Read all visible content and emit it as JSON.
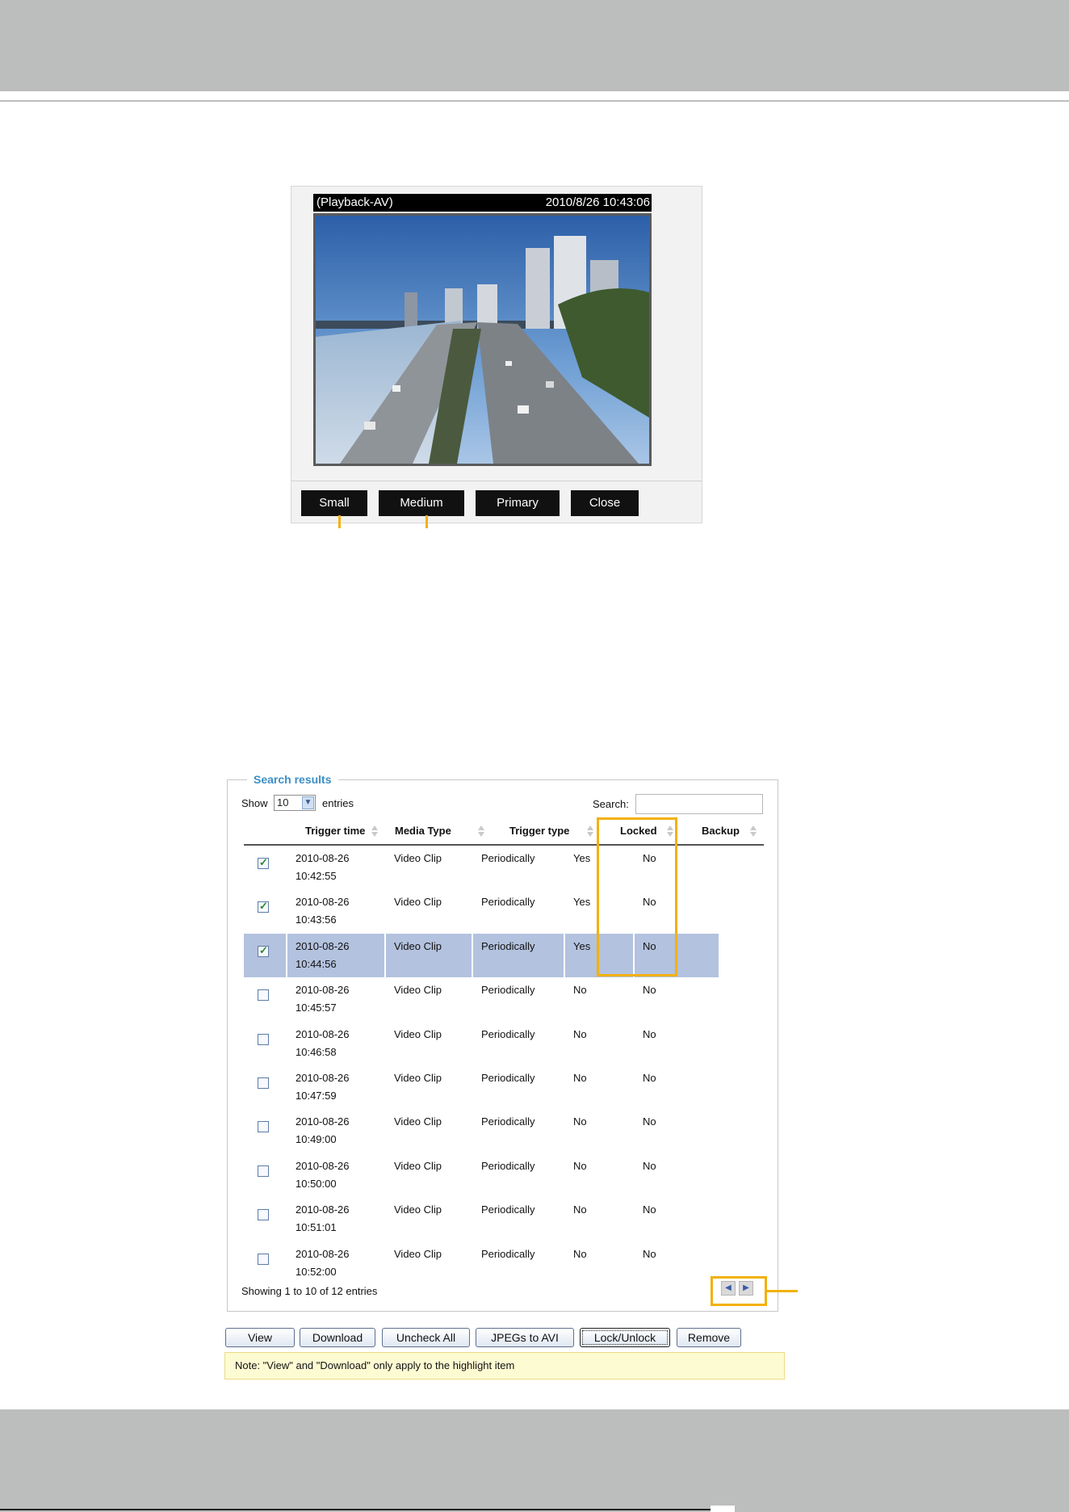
{
  "player": {
    "title_left": "(Playback-AV)",
    "title_right": "2010/8/26 10:43:06",
    "buttons": [
      "Small",
      "Medium",
      "Primary",
      "Close"
    ]
  },
  "search": {
    "legend": "Search results",
    "show_label": "Show",
    "entries_value": "10",
    "entries_label": "entries",
    "search_label": "Search:",
    "search_value": "",
    "columns": [
      "Trigger time",
      "Media Type",
      "Trigger type",
      "Locked",
      "Backup"
    ],
    "rows": [
      {
        "checked": true,
        "time_date": "2010-08-26",
        "time_clock": "10:42:55",
        "media": "Video Clip",
        "trigger": "Periodically",
        "locked": "Yes",
        "backup": "No",
        "highlighted": false
      },
      {
        "checked": true,
        "time_date": "2010-08-26",
        "time_clock": "10:43:56",
        "media": "Video Clip",
        "trigger": "Periodically",
        "locked": "Yes",
        "backup": "No",
        "highlighted": false
      },
      {
        "checked": true,
        "time_date": "2010-08-26",
        "time_clock": "10:44:56",
        "media": "Video Clip",
        "trigger": "Periodically",
        "locked": "Yes",
        "backup": "No",
        "highlighted": true
      },
      {
        "checked": false,
        "time_date": "2010-08-26",
        "time_clock": "10:45:57",
        "media": "Video Clip",
        "trigger": "Periodically",
        "locked": "No",
        "backup": "No",
        "highlighted": false
      },
      {
        "checked": false,
        "time_date": "2010-08-26",
        "time_clock": "10:46:58",
        "media": "Video Clip",
        "trigger": "Periodically",
        "locked": "No",
        "backup": "No",
        "highlighted": false
      },
      {
        "checked": false,
        "time_date": "2010-08-26",
        "time_clock": "10:47:59",
        "media": "Video Clip",
        "trigger": "Periodically",
        "locked": "No",
        "backup": "No",
        "highlighted": false
      },
      {
        "checked": false,
        "time_date": "2010-08-26",
        "time_clock": "10:49:00",
        "media": "Video Clip",
        "trigger": "Periodically",
        "locked": "No",
        "backup": "No",
        "highlighted": false
      },
      {
        "checked": false,
        "time_date": "2010-08-26",
        "time_clock": "10:50:00",
        "media": "Video Clip",
        "trigger": "Periodically",
        "locked": "No",
        "backup": "No",
        "highlighted": false
      },
      {
        "checked": false,
        "time_date": "2010-08-26",
        "time_clock": "10:51:01",
        "media": "Video Clip",
        "trigger": "Periodically",
        "locked": "No",
        "backup": "No",
        "highlighted": false
      },
      {
        "checked": false,
        "time_date": "2010-08-26",
        "time_clock": "10:52:00",
        "media": "Video Clip",
        "trigger": "Periodically",
        "locked": "No",
        "backup": "No",
        "highlighted": false
      }
    ],
    "footer": "Showing 1 to 10 of 12 entries",
    "pager": {
      "prev_icon": "prev-arrow-icon",
      "next_icon": "next-arrow-icon"
    }
  },
  "actions": [
    "View",
    "Download",
    "Uncheck All",
    "JPEGs to AVI",
    "Lock/Unlock",
    "Remove"
  ],
  "note": "Note: \"View\" and \"Download\" only apply to the highlight item",
  "colors": {
    "callout": "#f2b10c",
    "highlight_row": "#b3c2de",
    "legend": "#3b8fc7",
    "band": "#bcbdbd"
  }
}
